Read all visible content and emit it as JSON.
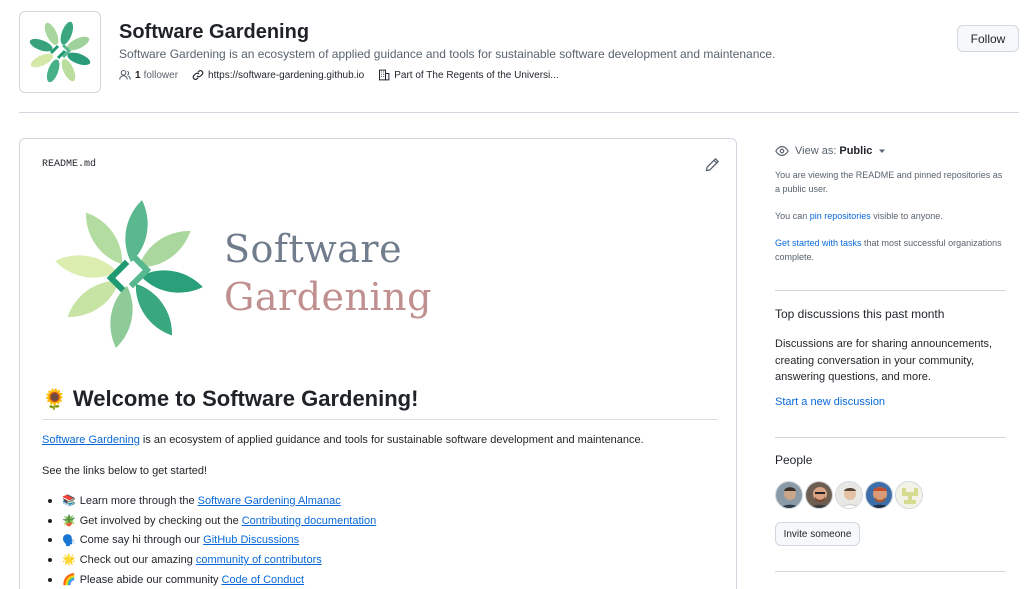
{
  "org": {
    "name": "Software Gardening",
    "description": "Software Gardening is an ecosystem of applied guidance and tools for sustainable software development and maintenance.",
    "followers_count": "1",
    "followers_label": "follower",
    "website": "https://software-gardening.github.io",
    "parent": "Part of The Regents of the Universi...",
    "follow_label": "Follow"
  },
  "readme": {
    "filename": "README.md",
    "logo_line1": "Software",
    "logo_line2": "Gardening",
    "heading_emoji": "🌻",
    "heading": "Welcome to Software Gardening!",
    "intro_link": "Software Gardening",
    "intro_text": " is an ecosystem of applied guidance and tools for sustainable software development and maintenance.",
    "started": "See the links below to get started!",
    "links": [
      {
        "emoji": "📚",
        "text": "Learn more through the",
        "link": "Software Gardening Almanac"
      },
      {
        "emoji": "🪴",
        "text": "Get involved by checking out the",
        "link": "Contributing documentation"
      },
      {
        "emoji": "🗣️",
        "text": "Come say hi through our",
        "link": "GitHub Discussions"
      },
      {
        "emoji": "🌟",
        "text": "Check out our amazing",
        "link": "community of contributors"
      },
      {
        "emoji": "🌈",
        "text": "Please abide our community",
        "link": "Code of Conduct"
      }
    ]
  },
  "sidebar": {
    "view_as_label": "View as:",
    "view_as_value": "Public",
    "viewing_text": "You are viewing the README and pinned repositories as a public user.",
    "pin_prefix": "You can ",
    "pin_link": "pin repositories",
    "pin_suffix": " visible to anyone.",
    "tasks_link": "Get started with tasks",
    "tasks_suffix": " that most successful organizations complete.",
    "discussions_heading": "Top discussions this past month",
    "discussions_body": "Discussions are for sharing announcements, creating conversation in your community, answering questions, and more.",
    "start_discussion": "Start a new discussion",
    "people_heading": "People",
    "invite_label": "Invite someone"
  },
  "colors": {
    "accent": "#0969da",
    "logo_gray": "#717d8c",
    "logo_rose": "#c08f8f",
    "leaf_dark": "#2fa37d",
    "leaf_light": "#c9e3a3"
  }
}
